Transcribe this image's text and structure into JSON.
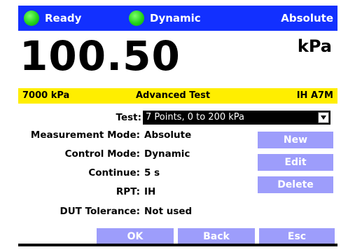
{
  "status": {
    "ready_label": "Ready",
    "mode_label": "Dynamic",
    "reference_label": "Absolute",
    "colors": {
      "bar": "#1230ff",
      "led": "#22d31b"
    }
  },
  "reading": {
    "value": "100.50",
    "unit": "kPa"
  },
  "infobar": {
    "range": "7000 kPa",
    "title": "Advanced Test",
    "module": "IH A7M",
    "color": "#ffee00"
  },
  "form": {
    "test_label": "Test:",
    "test_value": "7 Points, 0 to 200 kPa",
    "measurement_mode_label": "Measurement Mode:",
    "measurement_mode_value": "Absolute",
    "control_mode_label": "Control Mode:",
    "control_mode_value": "Dynamic",
    "continue_label": "Continue:",
    "continue_value": "5 s",
    "rpt_label": "RPT:",
    "rpt_value": "IH",
    "dut_tolerance_label": "DUT Tolerance:",
    "dut_tolerance_value": "Not used"
  },
  "side_buttons": {
    "new": "New",
    "edit": "Edit",
    "delete": "Delete"
  },
  "footer_buttons": {
    "ok": "OK",
    "back": "Back",
    "esc": "Esc"
  },
  "button_color": "#9d9dfb"
}
